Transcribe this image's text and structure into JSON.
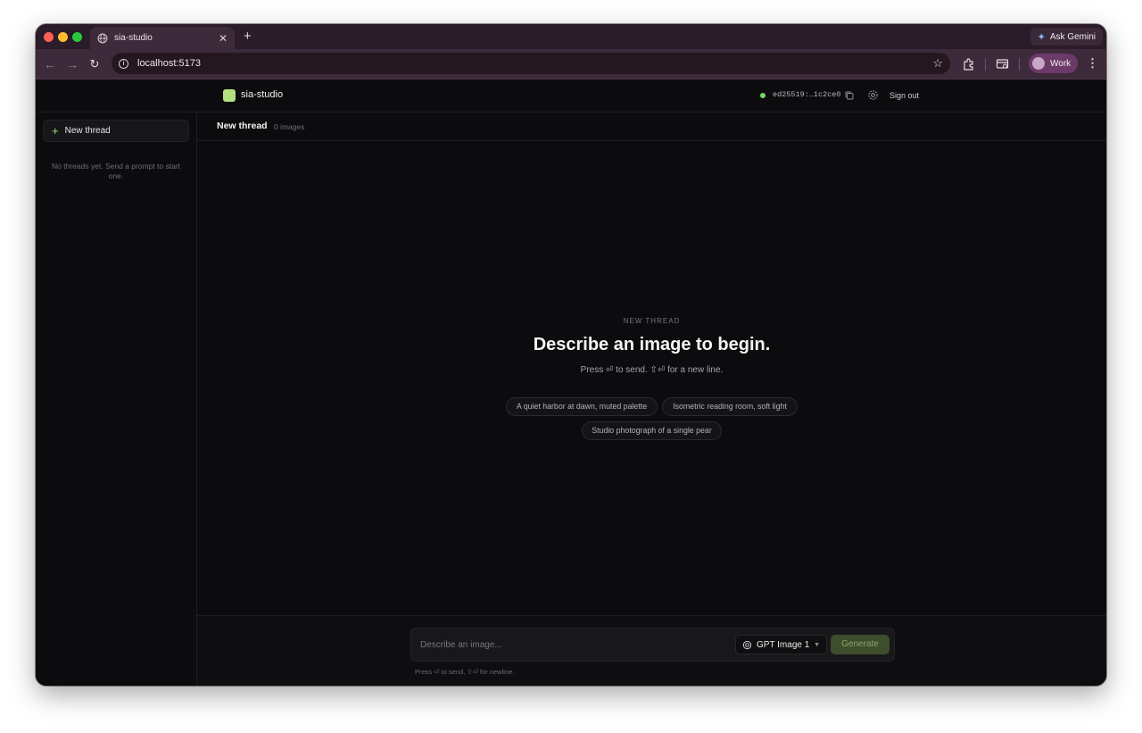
{
  "browser": {
    "tab_title": "sia-studio",
    "new_tab_symbol": "+",
    "url": "localhost:5173",
    "ask_gemini": "Ask Gemini",
    "profile_label": "Work"
  },
  "header": {
    "app_name": "sia-studio",
    "key_id": "ed25519:…1c2ce0",
    "sign_out": "Sign out",
    "status_color": "#77d86a",
    "logo_color": "#b3e07c"
  },
  "sidebar": {
    "new_thread_label": "New thread",
    "empty_note": "No threads yet. Send a prompt to start one."
  },
  "thread": {
    "title": "New thread",
    "image_count": "0 images"
  },
  "hero": {
    "eyebrow": "NEW THREAD",
    "title": "Describe an image to begin.",
    "subtitle": "Press ⏎ to send. ⇧⏎ for a new line."
  },
  "suggestions": [
    "A quiet harbor at dawn, muted palette",
    "Isometric reading room, soft light",
    "Studio photograph of a single pear"
  ],
  "composer": {
    "placeholder": "Describe an image...",
    "model": "GPT Image 1",
    "generate_label": "Generate",
    "hint": "Press ⏎ to send, ⇧⏎ for newline."
  }
}
